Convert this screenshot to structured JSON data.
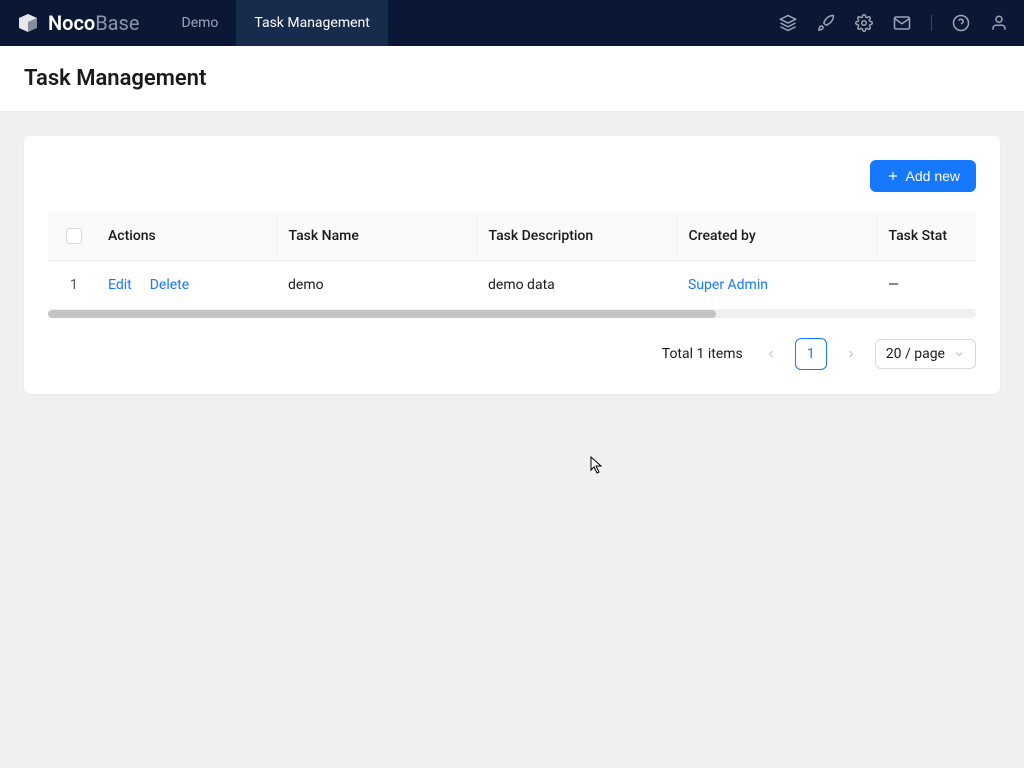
{
  "brand": {
    "name1": "Noco",
    "name2": "Base"
  },
  "nav": {
    "tabs": [
      {
        "label": "Demo",
        "active": false
      },
      {
        "label": "Task Management",
        "active": true
      }
    ]
  },
  "page": {
    "title": "Task Management"
  },
  "toolbar": {
    "add_new": "Add new"
  },
  "table": {
    "columns": {
      "actions": "Actions",
      "task_name": "Task Name",
      "task_description": "Task Description",
      "created_by": "Created by",
      "task_status": "Task Stat"
    },
    "rows": [
      {
        "index": "1",
        "edit": "Edit",
        "delete": "Delete",
        "task_name": "demo",
        "task_description": "demo data",
        "created_by": "Super Admin",
        "task_status": "—"
      }
    ]
  },
  "pagination": {
    "total": "Total 1 items",
    "current_page": "1",
    "page_size": "20 / page"
  }
}
